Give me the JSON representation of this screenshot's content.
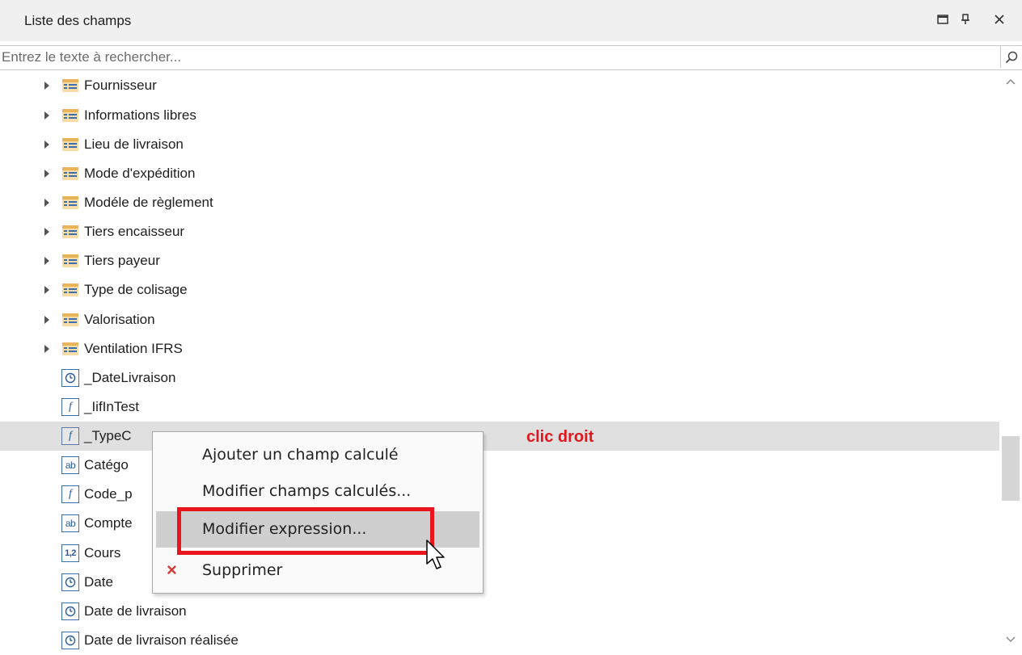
{
  "panel": {
    "title": "Liste des champs",
    "buttons": {
      "maximize": "maximize-icon",
      "pin": "pin-icon",
      "close": "close-icon"
    }
  },
  "search": {
    "placeholder": "Entrez le texte à rechercher...",
    "value": ""
  },
  "tree": {
    "items": [
      {
        "label": "Fournisseur",
        "icon": "table-icon",
        "expandable": true
      },
      {
        "label": "Informations libres",
        "icon": "table-icon",
        "expandable": true
      },
      {
        "label": "Lieu de livraison",
        "icon": "table-icon",
        "expandable": true
      },
      {
        "label": "Mode d'expédition",
        "icon": "table-icon",
        "expandable": true
      },
      {
        "label": "Modéle de règlement",
        "icon": "table-icon",
        "expandable": true
      },
      {
        "label": "Tiers encaisseur",
        "icon": "table-icon",
        "expandable": true
      },
      {
        "label": "Tiers payeur",
        "icon": "table-icon",
        "expandable": true
      },
      {
        "label": "Type de colisage",
        "icon": "table-icon",
        "expandable": true
      },
      {
        "label": "Valorisation",
        "icon": "table-icon",
        "expandable": true
      },
      {
        "label": "Ventilation IFRS",
        "icon": "table-icon",
        "expandable": true
      },
      {
        "label": "_DateLivraison",
        "icon": "clock-icon",
        "expandable": false
      },
      {
        "label": "_IifInTest",
        "icon": "function-icon",
        "expandable": false
      },
      {
        "label": "_TypeC",
        "icon": "function-icon",
        "expandable": false,
        "selected": true
      },
      {
        "label": "Catégo",
        "icon": "text-field-icon",
        "expandable": false
      },
      {
        "label": "Code_p",
        "icon": "function-icon",
        "expandable": false
      },
      {
        "label": "Compte",
        "icon": "text-field-icon",
        "expandable": false
      },
      {
        "label": "Cours",
        "icon": "number-field-icon",
        "expandable": false
      },
      {
        "label": "Date",
        "icon": "clock-icon",
        "expandable": false
      },
      {
        "label": "Date de livraison",
        "icon": "clock-icon",
        "expandable": false
      },
      {
        "label": "Date de livraison réalisée",
        "icon": "clock-icon",
        "expandable": false
      }
    ]
  },
  "annotation": {
    "text": "clic droit",
    "color": "#e0171c"
  },
  "context_menu": {
    "items": [
      {
        "label": "Ajouter un champ calculé"
      },
      {
        "label": "Modifier champs calculés..."
      },
      {
        "label": "Modifier expression...",
        "highlighted": true
      },
      {
        "label": "Supprimer",
        "icon": "delete-x-icon"
      }
    ]
  },
  "icon_glyphs": {
    "function": "f",
    "text": "ab",
    "number": "1,2"
  },
  "colors": {
    "highlight_box": "#e8161c",
    "selected_row": "#e0e0e0",
    "table_icon": "#e8b35a"
  }
}
